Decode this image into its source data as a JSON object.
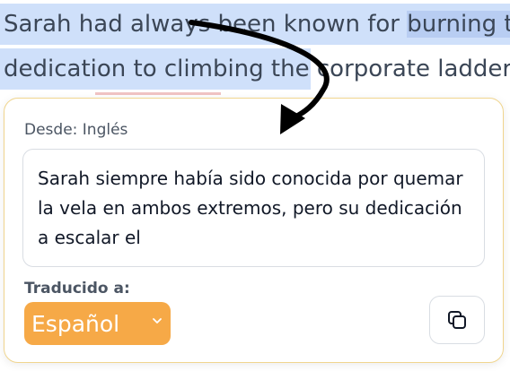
{
  "background": {
    "line1_a": "Sarah had always been known for ",
    "line1_b": "burning t",
    "line2_a": "dedication to climbing the ",
    "line2_b": "corporate ladder"
  },
  "popup": {
    "from_label": "Desde: Inglés",
    "translation_text": "Sarah siempre había sido conocida por quemar la vela en ambos extremos, pero su dedicación a escalar el",
    "to_label": "Traducido a:",
    "target_language": "Español",
    "icons": {
      "dropdown": "chevron-down-icon",
      "copy": "copy-icon",
      "annotation": "curved-arrow-icon"
    }
  },
  "colors": {
    "highlight": "#cfe0fa",
    "accent": "#f6a947",
    "popup_border": "#f0d58e"
  }
}
